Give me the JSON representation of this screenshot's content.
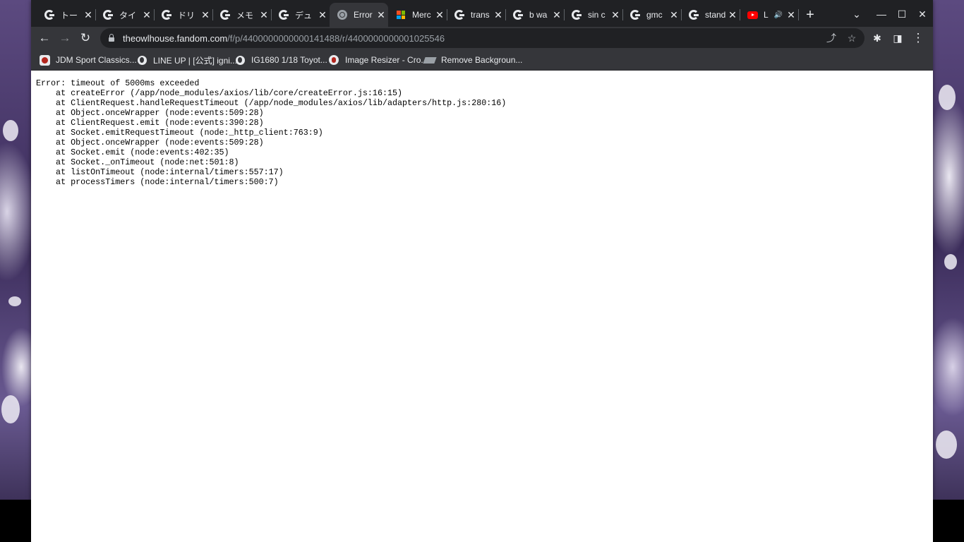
{
  "tabs": [
    {
      "title": "トー",
      "icon": "google-icon",
      "active": false
    },
    {
      "title": "タイ",
      "icon": "google-icon",
      "active": false
    },
    {
      "title": "ドリ",
      "icon": "google-icon",
      "active": false
    },
    {
      "title": "メモ",
      "icon": "google-icon",
      "active": false
    },
    {
      "title": "デュ",
      "icon": "google-icon",
      "active": false
    },
    {
      "title": "Error",
      "icon": "globe-icon",
      "active": true
    },
    {
      "title": "Merc",
      "icon": "microsoft-icon",
      "active": false
    },
    {
      "title": "trans",
      "icon": "google-icon",
      "active": false
    },
    {
      "title": "b wa",
      "icon": "google-icon",
      "active": false
    },
    {
      "title": "sin c",
      "icon": "google-icon",
      "active": false
    },
    {
      "title": "gmc",
      "icon": "google-icon",
      "active": false
    },
    {
      "title": "stand",
      "icon": "google-icon",
      "active": false
    },
    {
      "title": "L",
      "icon": "youtube-icon",
      "active": false,
      "audio": true
    }
  ],
  "glyphs": {
    "close": "✕",
    "new_tab": "+",
    "tab_search": "⌄",
    "minimize": "—",
    "maximize": "☐",
    "window_close": "✕",
    "back": "←",
    "forward": "→",
    "reload": "↻",
    "share": "⤴",
    "star": "☆",
    "extensions": "✱",
    "side_panel": "◨",
    "menu": "⋮",
    "audio": "🔊"
  },
  "address_bar": {
    "host": "theowlhouse.fandom.com",
    "path": "/f/p/4400000000000141488/r/4400000000001025546"
  },
  "bookmarks": [
    {
      "label": "JDM Sport Classics...",
      "icon": "jdm-favicon"
    },
    {
      "label": "LINE UP | [公式] igni...",
      "icon": "globe-icon"
    },
    {
      "label": "IG1680 1/18 Toyot...",
      "icon": "globe-icon"
    },
    {
      "label": "Image Resizer - Cro...",
      "icon": "image-resizer-icon"
    },
    {
      "label": "Remove Backgroun...",
      "icon": "remove-bg-icon"
    }
  ],
  "error_text": [
    "Error: timeout of 5000ms exceeded",
    "    at createError (/app/node_modules/axios/lib/core/createError.js:16:15)",
    "    at ClientRequest.handleRequestTimeout (/app/node_modules/axios/lib/adapters/http.js:280:16)",
    "    at Object.onceWrapper (node:events:509:28)",
    "    at ClientRequest.emit (node:events:390:28)",
    "    at Socket.emitRequestTimeout (node:_http_client:763:9)",
    "    at Object.onceWrapper (node:events:509:28)",
    "    at Socket.emit (node:events:402:35)",
    "    at Socket._onTimeout (node:net:501:8)",
    "    at listOnTimeout (node:internal/timers:557:17)",
    "    at processTimers (node:internal/timers:500:7)"
  ],
  "colors": {
    "tabstrip": "#202124",
    "toolbar": "#35363a",
    "text": "#e8eaed"
  }
}
